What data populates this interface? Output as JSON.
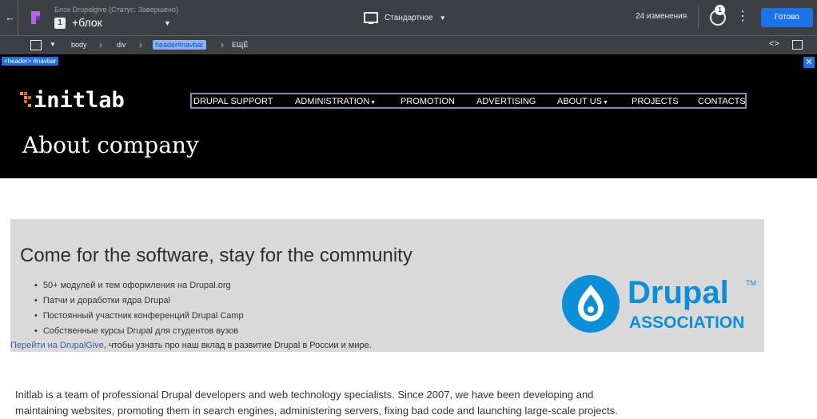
{
  "topbar": {
    "block_status": "Блок Drupalgive (Статус: Завершено)",
    "block_badge": "1",
    "block_name": "+блок",
    "device_label": "Стандартное",
    "changes": "24 изменения",
    "history_badge": "1",
    "done_label": "Готово"
  },
  "breadcrumb": {
    "items": [
      "body",
      "div",
      "header#navbar",
      "ЕЩЁ"
    ]
  },
  "selection": {
    "label": "<header> #navbar"
  },
  "site": {
    "logo_text": "initlab",
    "nav": [
      "DRUPAL SUPPORT",
      "ADMINISTRATION",
      "PROMOTION",
      "ADVERTISING",
      "ABOUT US",
      "PROJECTS",
      "CONTACTS"
    ],
    "page_title": "About company"
  },
  "banner": {
    "title": "Come for the software, stay for the community",
    "bullets": [
      "50+ модулей и тем оформления на Drupal.org",
      "Патчи и доработки ядра Drupal",
      "Постоянный участник конференций Drupal Camp",
      "Собственные курсы Drupal для студентов вузов"
    ],
    "link_text": "Перейти на DrupalGive",
    "link_rest": ", чтобы узнать про наш вклад в развитие Drupal в России и мире.",
    "brand_name": "Drupal",
    "brand_tm": "TM",
    "brand_sub": "ASSOCIATION"
  },
  "intro": {
    "line1": "Initlab is a team of professional Drupal developers and web technology specialists. Since 2007, we have been developing and",
    "line2": "maintaining websites, promoting them in search engines, administering servers, fixing bad code and launching large-scale projects."
  },
  "colors": {
    "editor_bg": "#3c4043",
    "accent": "#1a73e8",
    "drupal_blue": "#0a8fd8"
  }
}
